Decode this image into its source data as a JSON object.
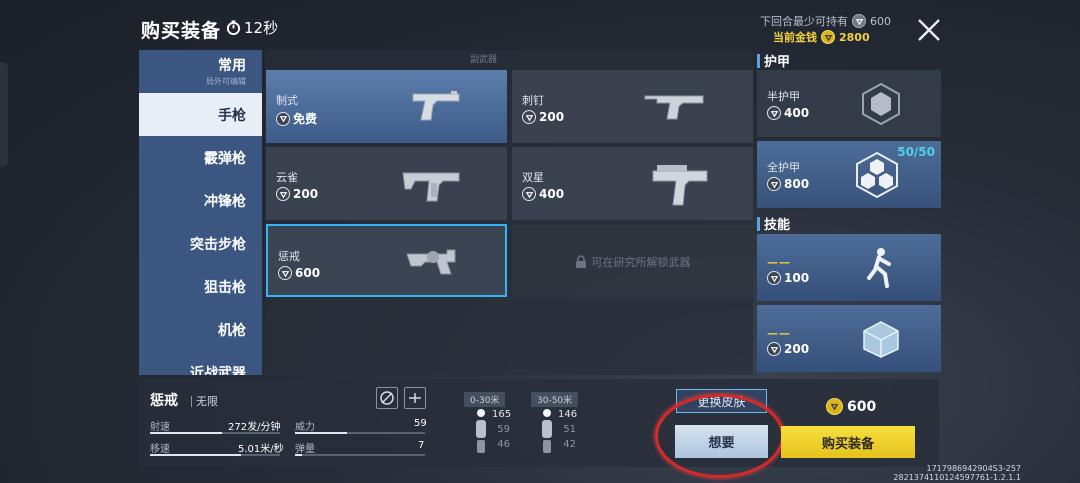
{
  "header": {
    "title": "购买装备",
    "timer": "12秒",
    "min_keep_label": "下回合最少可持有",
    "min_keep_value": "600",
    "current_money_label": "当前金钱",
    "current_money_value": "2800"
  },
  "sidebar": {
    "common": {
      "label": "常用",
      "sub": "局外可编辑"
    },
    "items": [
      {
        "label": "手枪",
        "active": true
      },
      {
        "label": "霰弹枪"
      },
      {
        "label": "冲锋枪"
      },
      {
        "label": "突击步枪"
      },
      {
        "label": "狙击枪"
      },
      {
        "label": "机枪"
      },
      {
        "label": "近战武器"
      }
    ]
  },
  "weapons": {
    "section_label": "副武器",
    "items": [
      {
        "name": "制式",
        "price": "免费"
      },
      {
        "name": "刺钉",
        "price": "200"
      },
      {
        "name": "云雀",
        "price": "200"
      },
      {
        "name": "双星",
        "price": "400"
      },
      {
        "name": "惩戒",
        "price": "600"
      }
    ],
    "locked_text": "可在研究所解锁武器"
  },
  "armor": {
    "title": "护甲",
    "items": [
      {
        "name": "半护甲",
        "price": "400"
      },
      {
        "name": "全护甲",
        "price": "800",
        "count": "50/50"
      }
    ]
  },
  "skills": {
    "title": "技能",
    "items": [
      {
        "dash": "——",
        "price": "100"
      },
      {
        "dash": "——",
        "price": "200"
      }
    ]
  },
  "detail": {
    "name": "惩戒",
    "ammo": "无限",
    "stats": [
      {
        "label": "射速",
        "value": "272发/分钟",
        "fill": 0.55
      },
      {
        "label": "移速",
        "value": "5.01米/秒",
        "fill": 0.7
      },
      {
        "label": "威力",
        "value": "59",
        "fill": 0.4
      },
      {
        "label": "弹量",
        "value": "7",
        "fill": 0.05
      }
    ],
    "ranges": [
      {
        "label": "0-30米",
        "values": [
          "165",
          "59",
          "46"
        ]
      },
      {
        "label": "30-50米",
        "values": [
          "146",
          "51",
          "42"
        ]
      }
    ]
  },
  "actions": {
    "skin": "更换皮肤",
    "want": "想要",
    "buy_price": "600",
    "buy": "购买装备"
  },
  "ids": {
    "line1": "1717986942904S3-257",
    "line2": "2821374110124597761-1.2.1.1"
  },
  "colors": {
    "accent": "#35b3f4",
    "gold": "#f3d13b",
    "sidebar": "#3c5682",
    "ring": "#d42a2a"
  }
}
